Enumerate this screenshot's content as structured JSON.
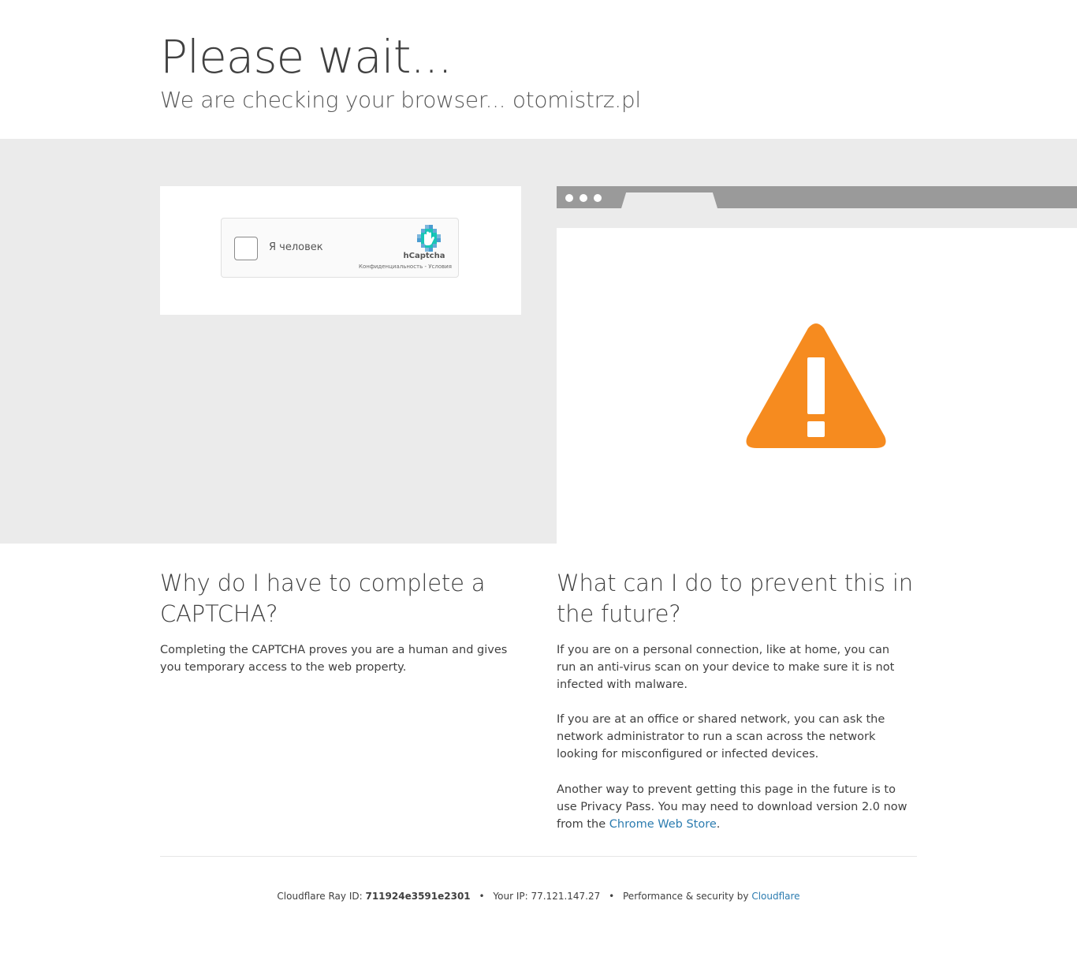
{
  "header": {
    "title": "Please wait...",
    "subtitle": "We are checking your browser... otomistrz.pl"
  },
  "captcha": {
    "checkbox_label": "Я человек",
    "brand": "hCaptcha",
    "privacy_link": "Конфиденциальность",
    "links_separator": " - ",
    "terms_link": "Условия",
    "checked": false
  },
  "sections": {
    "why": {
      "heading": "Why do I have to complete a CAPTCHA?",
      "body": "Completing the CAPTCHA proves you are a human and gives you temporary access to the web property."
    },
    "prevent": {
      "heading": "What can I do to prevent this in the future?",
      "p1": "If you are on a personal connection, like at home, you can run an anti-virus scan on your device to make sure it is not infected with malware.",
      "p2": "If you are at an office or shared network, you can ask the network administrator to run a scan across the network looking for misconfigured or infected devices.",
      "p3_before": "Another way to prevent getting this page in the future is to use Privacy Pass. You may need to download version 2.0 now from the ",
      "p3_link": "Chrome Web Store",
      "p3_after": "."
    }
  },
  "footer": {
    "ray_label": "Cloudflare Ray ID:",
    "ray_id": "711924e3591e2301",
    "separator": "•",
    "ip_label": "Your IP:",
    "ip": "77.121.147.27",
    "perf_label": "Performance & security by",
    "perf_link": "Cloudflare"
  },
  "colors": {
    "warning_orange": "#f68b1f",
    "link_blue": "#2c7cb0",
    "band_gray": "#ebebeb",
    "browser_bar_gray": "#9a9a9a"
  },
  "icons": {
    "warning": "warning-triangle-icon",
    "hcaptcha_logo": "hcaptcha-hand-icon"
  }
}
